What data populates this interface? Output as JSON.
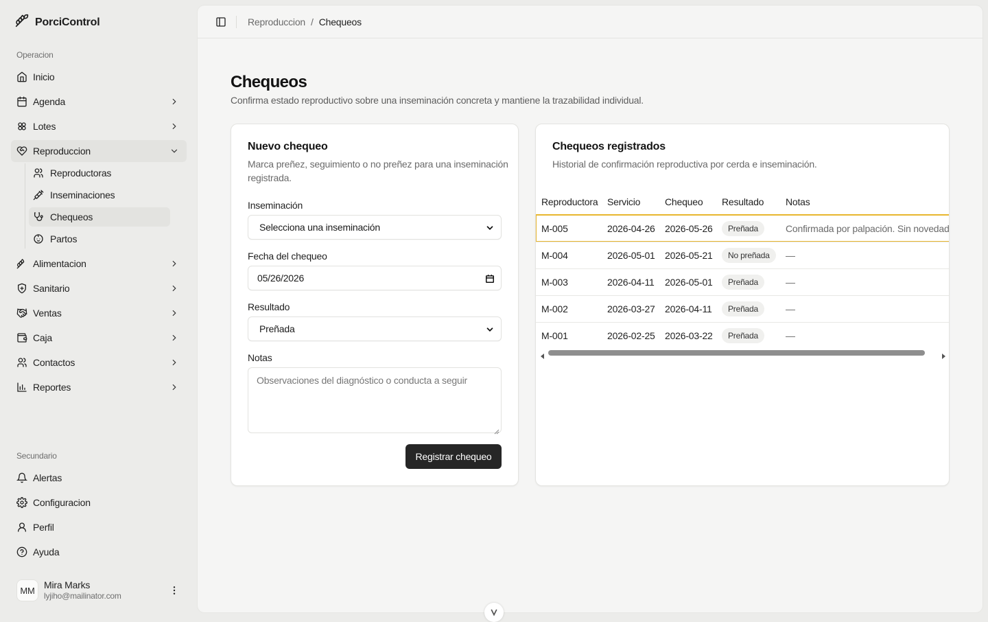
{
  "app": {
    "name": "PorciControl",
    "logo_icon": "pig-logo-icon"
  },
  "sidebar": {
    "group_operacion": "Operacion",
    "items": [
      {
        "label": "Inicio",
        "icon": "home-icon"
      },
      {
        "label": "Agenda",
        "icon": "calendar-icon"
      },
      {
        "label": "Lotes",
        "icon": "groups-icon"
      },
      {
        "label": "Reproduccion",
        "icon": "heart-handshake-icon"
      },
      {
        "label": "Alimentacion",
        "icon": "wheat-icon"
      },
      {
        "label": "Sanitario",
        "icon": "shield-plus-icon"
      },
      {
        "label": "Ventas",
        "icon": "handshake-icon"
      },
      {
        "label": "Caja",
        "icon": "wallet-icon"
      },
      {
        "label": "Contactos",
        "icon": "users-icon"
      },
      {
        "label": "Reportes",
        "icon": "bar-chart-icon"
      }
    ],
    "sub_items": [
      {
        "label": "Reproductoras",
        "icon": "users-icon"
      },
      {
        "label": "Inseminaciones",
        "icon": "syringe-icon"
      },
      {
        "label": "Chequeos",
        "icon": "stethoscope-icon"
      },
      {
        "label": "Partos",
        "icon": "baby-icon"
      }
    ],
    "group_secundario": "Secundario",
    "secondary": [
      {
        "label": "Alertas",
        "icon": "bell-icon"
      },
      {
        "label": "Configuracion",
        "icon": "gear-icon"
      },
      {
        "label": "Perfil",
        "icon": "user-icon"
      },
      {
        "label": "Ayuda",
        "icon": "help-circle-icon"
      }
    ],
    "user": {
      "initials": "MM",
      "name": "Mira Marks",
      "email": "lyjiho@mailinator.com"
    }
  },
  "header": {
    "crumb_parent": "Reproduccion",
    "crumb_sep": "/",
    "crumb_current": "Chequeos"
  },
  "page": {
    "title": "Chequeos",
    "subtitle": "Confirma estado reproductivo sobre una inseminación concreta y mantiene la trazabilidad individual."
  },
  "form": {
    "title": "Nuevo chequeo",
    "description": "Marca preñez, seguimiento o no preñez para una inseminación registrada.",
    "insem_label": "Inseminación",
    "insem_value": "Selecciona una inseminación",
    "date_label": "Fecha del chequeo",
    "date_value": "05/26/2026",
    "result_label": "Resultado",
    "result_value": "Preñada",
    "notes_label": "Notas",
    "notes_placeholder": "Observaciones del diagnóstico o conducta a seguir",
    "submit_label": "Registrar chequeo"
  },
  "table": {
    "title": "Chequeos registrados",
    "description": "Historial de confirmación reproductiva por cerda e inseminación.",
    "columns": [
      "Reproductora",
      "Servicio",
      "Chequeo",
      "Resultado",
      "Notas"
    ],
    "rows": [
      [
        "M-005",
        "2026-04-26",
        "2026-05-26",
        "Preñada",
        "Confirmada por palpación. Sin novedade"
      ],
      [
        "M-004",
        "2026-05-01",
        "2026-05-21",
        "No preñada",
        "—"
      ],
      [
        "M-003",
        "2026-04-11",
        "2026-05-01",
        "Preñada",
        "—"
      ],
      [
        "M-002",
        "2026-03-27",
        "2026-04-11",
        "Preñada",
        "—"
      ],
      [
        "M-001",
        "2026-02-25",
        "2026-03-22",
        "Preñada",
        "—"
      ]
    ]
  },
  "colors": {
    "highlight": "#e8b62d",
    "button": "#262626",
    "sidebar_bg": "#ececea",
    "main_bg": "#f5f5f4"
  }
}
